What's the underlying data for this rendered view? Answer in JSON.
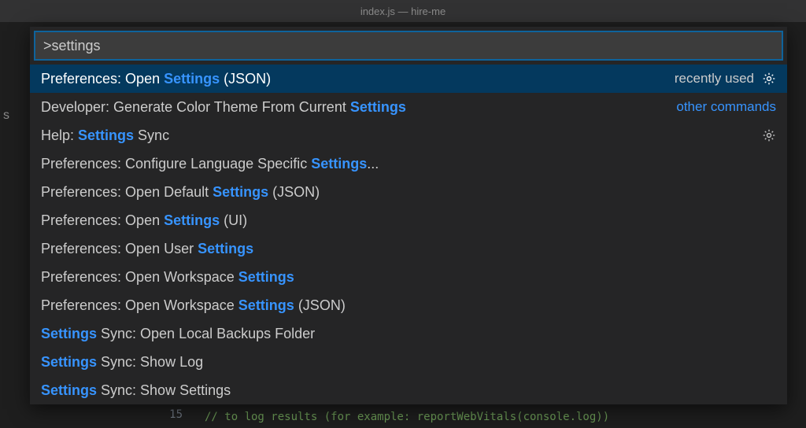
{
  "titlebar": {
    "text": "index.js — hire-me"
  },
  "palette": {
    "input_value": ">settings",
    "query": "settings",
    "items": [
      {
        "label": "Preferences: Open Settings (JSON)",
        "meta": "recently used",
        "gear": true,
        "selected": true
      },
      {
        "label": "Developer: Generate Color Theme From Current Settings",
        "meta": "other commands",
        "meta_link": true
      },
      {
        "label": "Help: Settings Sync",
        "gear": true
      },
      {
        "label": "Preferences: Configure Language Specific Settings..."
      },
      {
        "label": "Preferences: Open Default Settings (JSON)"
      },
      {
        "label": "Preferences: Open Settings (UI)"
      },
      {
        "label": "Preferences: Open User Settings"
      },
      {
        "label": "Preferences: Open Workspace Settings"
      },
      {
        "label": "Preferences: Open Workspace Settings (JSON)"
      },
      {
        "label": "Settings Sync: Open Local Backups Folder"
      },
      {
        "label": "Settings Sync: Show Log"
      },
      {
        "label": "Settings Sync: Show Settings"
      }
    ]
  },
  "editor": {
    "visible_lines": [
      {
        "num": 15,
        "text": "// to log results (for example: reportWebVitals(console.log))"
      }
    ]
  },
  "sidebar_fragment": "s"
}
